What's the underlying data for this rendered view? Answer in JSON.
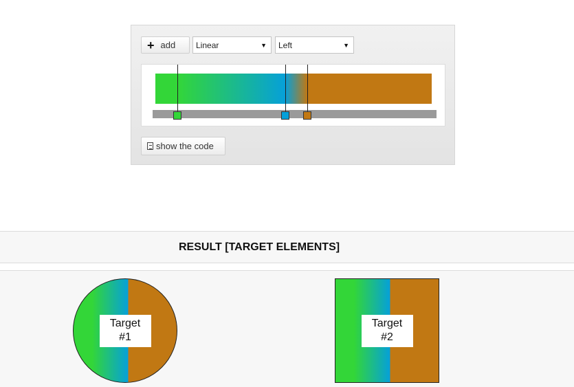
{
  "editor": {
    "add_label": "add",
    "type_select": {
      "value": "Linear"
    },
    "direction_select": {
      "value": "Left"
    },
    "show_code_label": "show the code",
    "gradient_stops": [
      {
        "color": "#33d638",
        "position_pct": 8
      },
      {
        "color": "#06a0d9",
        "position_pct": 47
      },
      {
        "color": "#c17813",
        "position_pct": 55
      }
    ]
  },
  "result": {
    "title": "RESULT [TARGET ELEMENTS]",
    "targets": [
      {
        "label": "Target\n#1"
      },
      {
        "label": "Target\n#2"
      }
    ]
  },
  "icons": [
    "plus-icon",
    "chevron-down-icon",
    "document-icon"
  ]
}
